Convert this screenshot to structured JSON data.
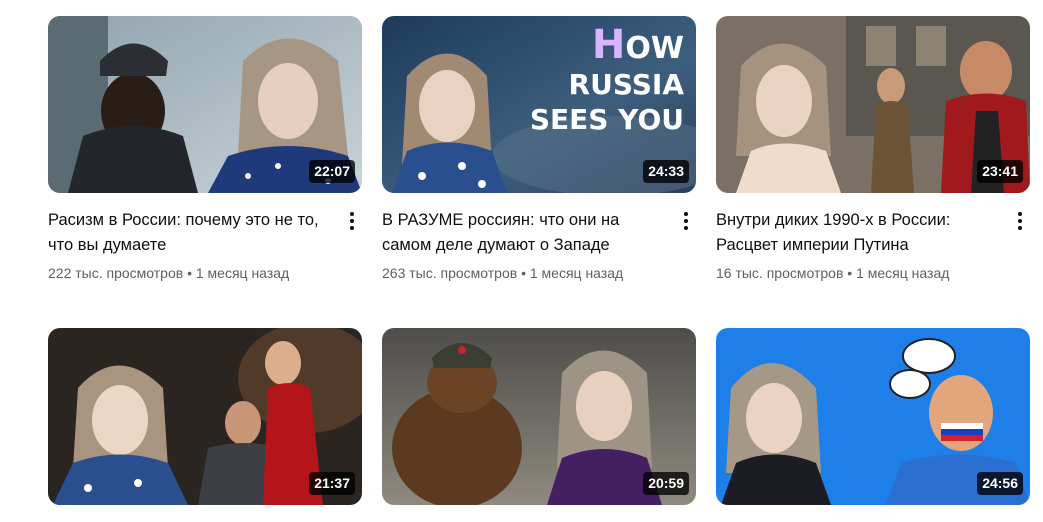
{
  "videos": [
    {
      "title": "Расизм в России: почему это не то, что вы думаете",
      "views": "222 тыс. просмотров",
      "separator": "•",
      "age": "1 месяц назад",
      "duration": "22:07",
      "menu_icon": "more-vert-icon"
    },
    {
      "title": "В РАЗУМЕ россиян: что они на самом деле думают о Западе",
      "views": "263 тыс. просмотров",
      "separator": "•",
      "age": "1 месяц назад",
      "duration": "24:33",
      "thumb_text": {
        "line1_cap": "H",
        "line1_rest": "OW",
        "line2": "RUSSIA",
        "line3": "SEES YOU"
      },
      "menu_icon": "more-vert-icon"
    },
    {
      "title": "Внутри диких 1990-х в России: Расцвет империи Путина",
      "views": "16 тыс. просмотров",
      "separator": "•",
      "age": "1 месяц назад",
      "duration": "23:41",
      "menu_icon": "more-vert-icon"
    },
    {
      "duration": "21:37"
    },
    {
      "duration": "20:59"
    },
    {
      "duration": "24:56"
    }
  ],
  "colors": {
    "title_text": "#0f0f0f",
    "meta_text": "#606060",
    "duration_bg": "#000000",
    "background": "#ffffff"
  }
}
